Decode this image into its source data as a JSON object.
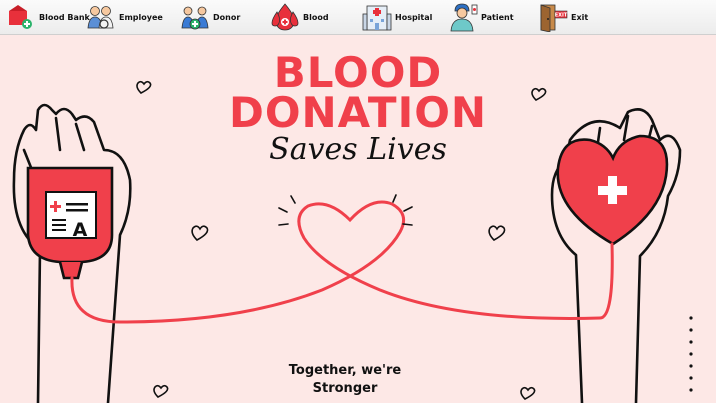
{
  "menu": {
    "items": [
      {
        "label": "Blood Bank",
        "icon": "blood-bank-icon"
      },
      {
        "label": "Employee",
        "icon": "employee-icon"
      },
      {
        "label": "Donor",
        "icon": "donor-icon"
      },
      {
        "label": "Blood",
        "icon": "blood-drop-icon"
      },
      {
        "label": "Hospital",
        "icon": "hospital-icon"
      },
      {
        "label": "Patient",
        "icon": "patient-icon"
      },
      {
        "label": "Exit",
        "icon": "exit-door-icon"
      }
    ]
  },
  "hero": {
    "title_line1": "BLOOD",
    "title_line2": "DONATION",
    "subtitle": "Saves Lives",
    "tagline_line1": "Together, we're",
    "tagline_line2": "Stronger",
    "bag_label": "A"
  },
  "colors": {
    "accent": "#f0404b",
    "background": "#fde8e6",
    "ink": "#111111"
  }
}
